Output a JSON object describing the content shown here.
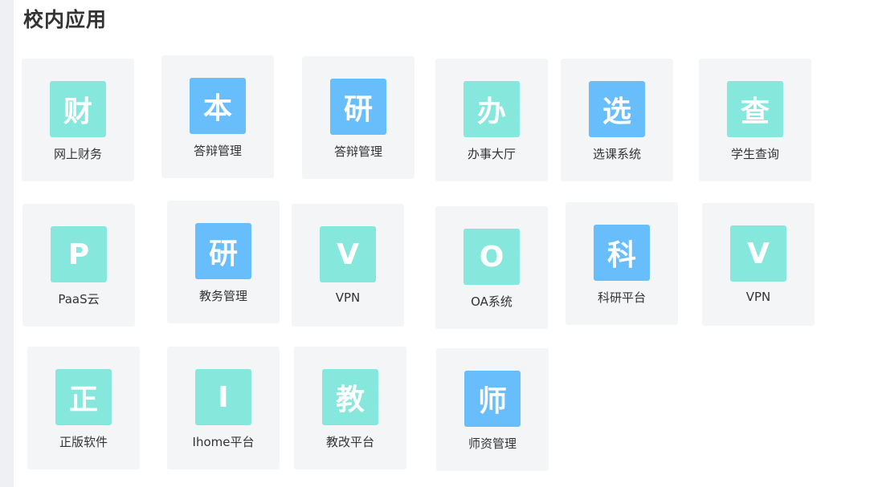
{
  "page": {
    "title": "校内应用"
  },
  "colors": {
    "teal": "#86e7dc",
    "blue": "#68bdfb",
    "card_bg": "#f4f5f7"
  },
  "apps": [
    {
      "id": "finance",
      "glyph": "财",
      "label": "网上财务",
      "color": "teal"
    },
    {
      "id": "undergrad-defense",
      "glyph": "本",
      "label": "答辩管理",
      "color": "blue"
    },
    {
      "id": "grad-defense",
      "glyph": "研",
      "label": "答辩管理",
      "color": "blue"
    },
    {
      "id": "service-hall",
      "glyph": "办",
      "label": "办事大厅",
      "color": "teal"
    },
    {
      "id": "course-selection",
      "glyph": "选",
      "label": "选课系统",
      "color": "blue"
    },
    {
      "id": "student-query",
      "glyph": "查",
      "label": "学生查询",
      "color": "teal"
    },
    {
      "id": "paas-cloud",
      "glyph": "P",
      "label": "PaaS云",
      "color": "teal"
    },
    {
      "id": "grad-academic",
      "glyph": "研",
      "label": "教务管理",
      "color": "blue"
    },
    {
      "id": "vpn-1",
      "glyph": "V",
      "label": "VPN",
      "color": "teal"
    },
    {
      "id": "oa-system",
      "glyph": "O",
      "label": "OA系统",
      "color": "teal"
    },
    {
      "id": "research-platform",
      "glyph": "科",
      "label": "科研平台",
      "color": "blue"
    },
    {
      "id": "vpn-2",
      "glyph": "V",
      "label": "VPN",
      "color": "teal"
    },
    {
      "id": "licensed-software",
      "glyph": "正",
      "label": "正版软件",
      "color": "teal"
    },
    {
      "id": "ihome",
      "glyph": "I",
      "label": "Ihome平台",
      "color": "teal"
    },
    {
      "id": "teaching-reform",
      "glyph": "教",
      "label": "教改平台",
      "color": "teal"
    },
    {
      "id": "faculty-management",
      "glyph": "师",
      "label": "师资管理",
      "color": "blue"
    }
  ]
}
